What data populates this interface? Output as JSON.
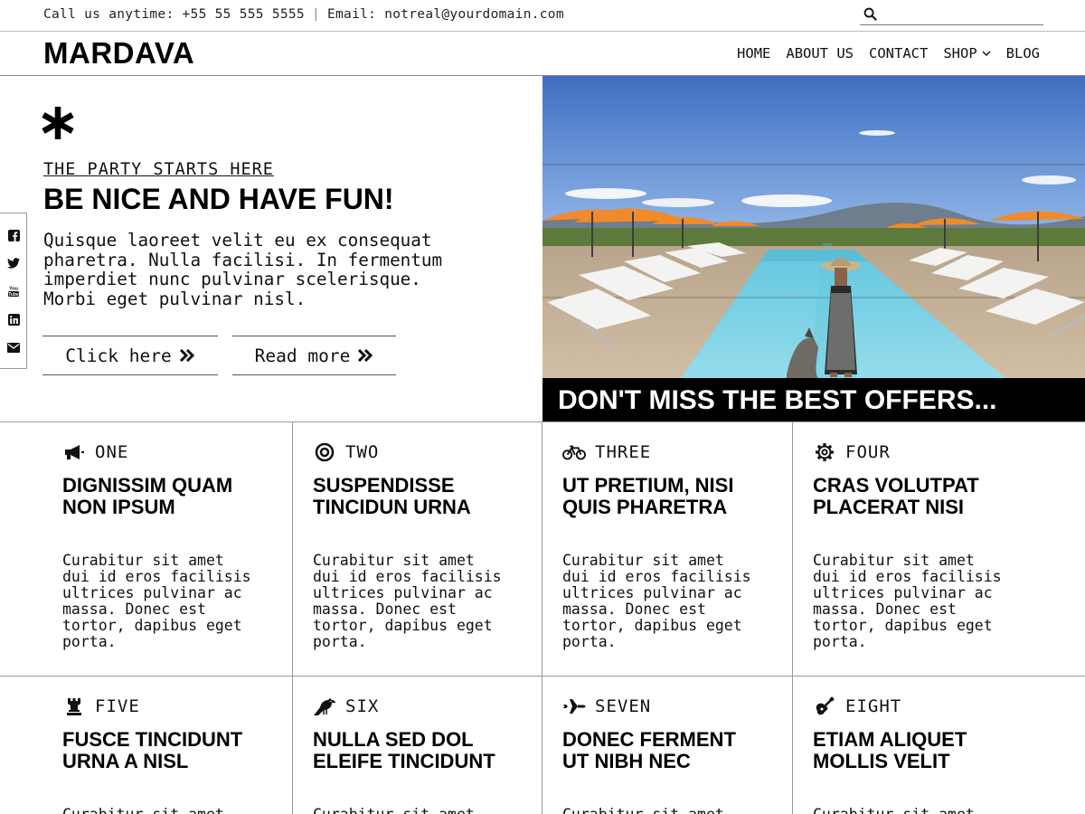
{
  "topbar": {
    "phone_text": "Call us anytime: +55 55 555 5555",
    "separator": "|",
    "email_text": "Email: notreal@yourdomain.com",
    "search_placeholder": "",
    "search_icon": "search-icon"
  },
  "header": {
    "logo": "MARDAVA",
    "nav": [
      {
        "label": "HOME"
      },
      {
        "label": "ABOUT US"
      },
      {
        "label": "CONTACT"
      },
      {
        "label": "SHOP",
        "has_dropdown": true
      },
      {
        "label": "BLOG"
      }
    ]
  },
  "hero": {
    "icon": "asterisk-icon",
    "tagline": "THE PARTY STARTS HERE",
    "title": "BE NICE AND HAVE FUN!",
    "body_lines": [
      "Quisque laoreet velit eu ex consequat",
      "pharetra. Nulla facilisi. In fermentum",
      "imperdiet nunc pulvinar scelerisque.",
      "Morbi eget pulvinar nisl."
    ],
    "buttons": [
      {
        "label": "Click here",
        "icon": "double-chevron-right-icon"
      },
      {
        "label": "Read more",
        "icon": "double-chevron-right-icon"
      }
    ]
  },
  "social": [
    "facebook-icon",
    "twitter-icon",
    "youtube-icon",
    "linkedin-icon",
    "envelope-icon"
  ],
  "hero_image": {
    "banner_text": "DON'T MISS THE BEST OFFERS..."
  },
  "features": [
    {
      "icon": "megaphone-icon",
      "number": "ONE",
      "title_lines": [
        "DIGNISSIM QUAM",
        "NON IPSUM"
      ],
      "body_lines": [
        "Curabitur sit amet",
        "dui id eros facilisis",
        "ultrices pulvinar ac",
        "massa. Donec est",
        "tortor, dapibus eget",
        "porta."
      ]
    },
    {
      "icon": "target-icon",
      "number": "TWO",
      "title_lines": [
        "SUSPENDISSE",
        "TINCIDUN URNA"
      ],
      "body_lines": [
        "Curabitur sit amet",
        "dui id eros facilisis",
        "ultrices pulvinar ac",
        "massa. Donec est",
        "tortor, dapibus eget",
        "porta."
      ]
    },
    {
      "icon": "bicycle-icon",
      "number": "THREE",
      "title_lines": [
        "UT PRETIUM, NISI",
        "QUIS PHARETRA"
      ],
      "body_lines": [
        "Curabitur sit amet",
        "dui id eros facilisis",
        "ultrices pulvinar ac",
        "massa. Donec est",
        "tortor, dapibus eget",
        "porta."
      ]
    },
    {
      "icon": "gear-icon",
      "number": "FOUR",
      "title_lines": [
        "CRAS VOLUTPAT",
        "PLACERAT NISI"
      ],
      "body_lines": [
        "Curabitur sit amet",
        "dui id eros facilisis",
        "ultrices pulvinar ac",
        "massa. Donec est",
        "tortor, dapibus eget",
        "porta."
      ]
    },
    {
      "icon": "chess-rook-icon",
      "number": "FIVE",
      "title_lines": [
        "FUSCE TINCIDUNT",
        "URNA A NISL"
      ],
      "body_lines": [
        "Curabitur sit amet"
      ]
    },
    {
      "icon": "crow-icon",
      "number": "SIX",
      "title_lines": [
        "NULLA SED DOL",
        "ELEIFE TINCIDUNT"
      ],
      "body_lines": [
        "Curabitur sit amet"
      ]
    },
    {
      "icon": "plane-icon",
      "number": "SEVEN",
      "title_lines": [
        "DONEC FERMENT",
        "UT NIBH NEC"
      ],
      "body_lines": [
        "Curabitur sit amet"
      ]
    },
    {
      "icon": "guitar-icon",
      "number": "EIGHT",
      "title_lines": [
        "ETIAM ALIQUET",
        "MOLLIS VELIT"
      ],
      "body_lines": [
        "Curabitur sit amet"
      ]
    }
  ]
}
